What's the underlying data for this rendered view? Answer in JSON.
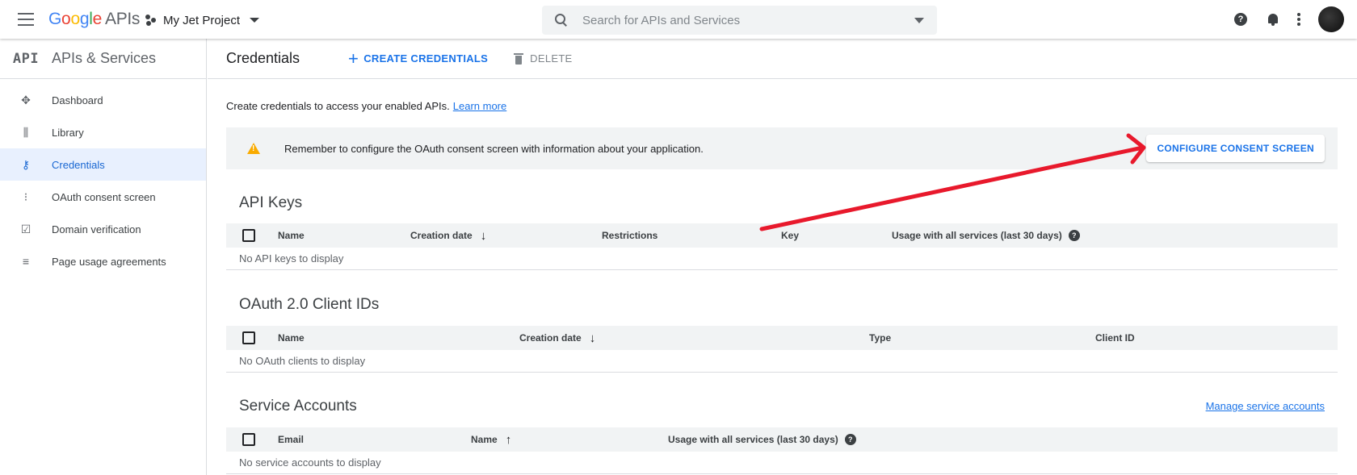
{
  "topbar": {
    "logo_google": [
      "G",
      "o",
      "o",
      "g",
      "l",
      "e"
    ],
    "logo_apis": "APIs",
    "project_name": "My Jet Project",
    "search_placeholder": "Search for APIs and Services",
    "help_glyph": "?"
  },
  "sidebar": {
    "mark": "API",
    "title": "APIs & Services",
    "items": [
      {
        "label": "Dashboard",
        "icon": "dashboard-icon",
        "glyph": "✥"
      },
      {
        "label": "Library",
        "icon": "library-icon",
        "glyph": "⫼"
      },
      {
        "label": "Credentials",
        "icon": "key-icon",
        "glyph": "⚷",
        "active": true
      },
      {
        "label": "OAuth consent screen",
        "icon": "consent-icon",
        "glyph": "⁝"
      },
      {
        "label": "Domain verification",
        "icon": "checkbox-icon",
        "glyph": "☑"
      },
      {
        "label": "Page usage agreements",
        "icon": "settings-list-icon",
        "glyph": "≡"
      }
    ]
  },
  "header": {
    "title": "Credentials",
    "create_label": "CREATE CREDENTIALS",
    "delete_label": "DELETE"
  },
  "intro": {
    "text": "Create credentials to access your enabled APIs.",
    "link": "Learn more"
  },
  "alert": {
    "text": "Remember to configure the OAuth consent screen with information about your application.",
    "button": "CONFIGURE CONSENT SCREEN"
  },
  "api_keys": {
    "title": "API Keys",
    "columns": [
      "Name",
      "Creation date",
      "Restrictions",
      "Key",
      "Usage with all services (last 30 days)"
    ],
    "empty": "No API keys to display"
  },
  "oauth": {
    "title": "OAuth 2.0 Client IDs",
    "columns": [
      "Name",
      "Creation date",
      "Type",
      "Client ID"
    ],
    "empty": "No OAuth clients to display"
  },
  "service_accounts": {
    "title": "Service Accounts",
    "manage_link": "Manage service accounts",
    "columns": [
      "Email",
      "Name",
      "Usage with all services (last 30 days)"
    ],
    "empty": "No service accounts to display"
  },
  "colors": {
    "accent": "#1a73e8",
    "warning": "#f9ab00",
    "annotation_arrow": "#e8192c"
  }
}
